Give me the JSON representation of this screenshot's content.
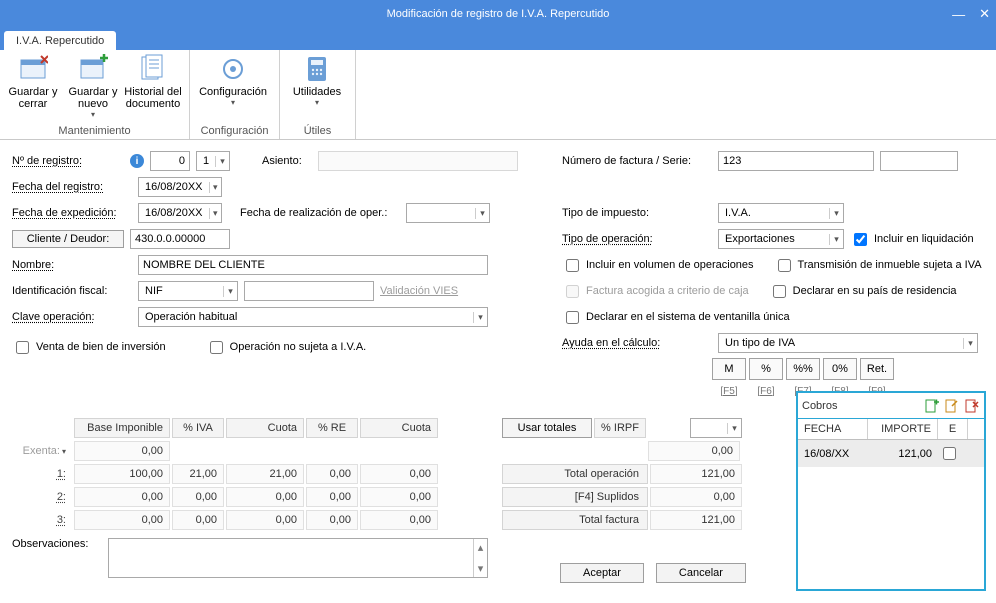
{
  "window": {
    "title": "Modificación de registro de I.V.A. Repercutido"
  },
  "tab": {
    "label": "I.V.A. Repercutido"
  },
  "ribbon": {
    "groups": [
      {
        "label": "Mantenimiento",
        "buttons": [
          {
            "label": "Guardar y cerrar",
            "name": "guardar-cerrar-button"
          },
          {
            "label": "Guardar y nuevo",
            "name": "guardar-nuevo-button",
            "dropdown": true
          },
          {
            "label": "Historial del documento",
            "name": "historial-button"
          }
        ]
      },
      {
        "label": "Configuración",
        "buttons": [
          {
            "label": "Configuración",
            "name": "configuracion-button",
            "dropdown": true
          }
        ]
      },
      {
        "label": "Útiles",
        "buttons": [
          {
            "label": "Utilidades",
            "name": "utilidades-button",
            "dropdown": true
          }
        ]
      }
    ]
  },
  "left": {
    "num_registro_label": "Nº de registro:",
    "num_registro_value": "0",
    "num_registro_serie": "1",
    "asiento_label": "Asiento:",
    "asiento_value": "",
    "fecha_registro_label": "Fecha del registro:",
    "fecha_registro_value": "16/08/20XX",
    "fecha_expedicion_label": "Fecha de expedición:",
    "fecha_expedicion_value": "16/08/20XX",
    "fecha_realizacion_label": "Fecha de realización de oper.:",
    "fecha_realizacion_value": "",
    "cliente_btn": "Cliente / Deudor:",
    "cliente_value": "430.0.0.00000",
    "nombre_label": "Nombre:",
    "nombre_value": "NOMBRE DEL CLIENTE",
    "id_fiscal_label": "Identificación fiscal:",
    "id_fiscal_tipo": "NIF",
    "id_fiscal_valor": "",
    "validacion_vies": "Validación VIES",
    "clave_op_label": "Clave operación:",
    "clave_op_value": "Operación habitual",
    "venta_inversion_label": "Venta de bien de inversión",
    "op_no_sujeta_label": "Operación no sujeta a I.V.A."
  },
  "right": {
    "numfact_label": "Número de factura / Serie:",
    "numfact_value": "123",
    "numfact_serie": "",
    "tipo_impuesto_label": "Tipo de impuesto:",
    "tipo_impuesto_value": "I.V.A.",
    "tipo_operacion_label": "Tipo de operación:",
    "tipo_operacion_value": "Exportaciones",
    "incluir_liq_label": "Incluir en liquidación",
    "incluir_liq_checked": true,
    "incluir_volumen_label": "Incluir en volumen de operaciones",
    "transmision_inmueble_label": "Transmisión de inmueble sujeta a IVA",
    "factura_criterio_caja_label": "Factura acogida a criterio de caja",
    "declarar_pais_label": "Declarar en su país de residencia",
    "declarar_ventanilla_label": "Declarar en el sistema de ventanilla única",
    "ayuda_calculo_label": "Ayuda en el cálculo:",
    "ayuda_calculo_value": "Un tipo de IVA",
    "calc_buttons": [
      "M",
      "%",
      "%%",
      "0%",
      "Ret."
    ],
    "calc_fkeys": [
      "[F5]",
      "[F6]",
      "[F7]",
      "[F8]",
      "[F9]"
    ]
  },
  "grid": {
    "headers": [
      "Base Imponible",
      "% IVA",
      "Cuota",
      "% RE",
      "Cuota"
    ],
    "usar_totales": "Usar totales",
    "irpf_label": "% IRPF",
    "exenta_label": "Exenta:",
    "rows": [
      {
        "prefix": "1:",
        "base": "100,00",
        "piva": "21,00",
        "cuota": "21,00",
        "pre": "0,00",
        "cuotare": "0,00"
      },
      {
        "prefix": "2:",
        "base": "0,00",
        "piva": "0,00",
        "cuota": "0,00",
        "pre": "0,00",
        "cuotare": "0,00"
      },
      {
        "prefix": "3:",
        "base": "0,00",
        "piva": "0,00",
        "cuota": "0,00",
        "pre": "0,00",
        "cuotare": "0,00"
      }
    ],
    "exenta_value": "0,00",
    "irpf_value": "0,00",
    "total_operacion_label": "Total operación",
    "total_operacion_value": "121,00",
    "suplidos_label": "[F4] Suplidos",
    "suplidos_value": "0,00",
    "total_factura_label": "Total factura",
    "total_factura_value": "121,00"
  },
  "observaciones_label": "Observaciones:",
  "buttons": {
    "aceptar": "Aceptar",
    "cancelar": "Cancelar"
  },
  "cobros": {
    "title": "Cobros",
    "headers": [
      "FECHA",
      "IMPORTE",
      "E"
    ],
    "row": {
      "fecha": "16/08/XX",
      "importe": "121,00"
    }
  }
}
